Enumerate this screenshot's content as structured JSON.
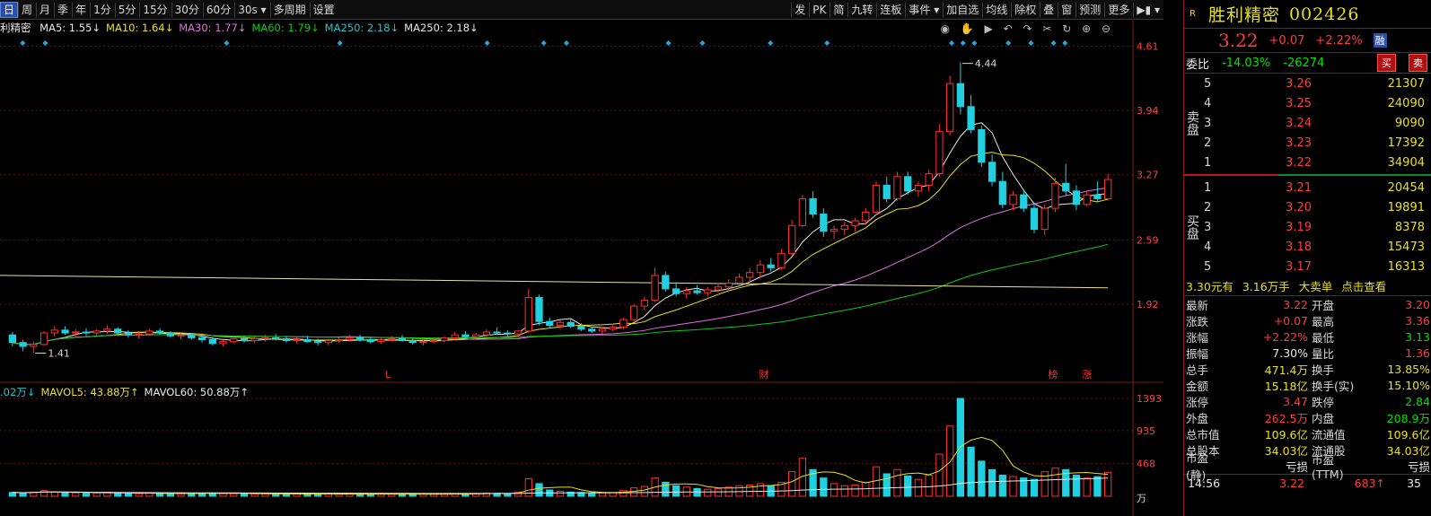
{
  "toolbar": {
    "left": [
      "日",
      "周",
      "月",
      "季",
      "年",
      "1分",
      "5分",
      "15分",
      "30分",
      "60分",
      "30s ▾",
      "多周期",
      "设置"
    ],
    "active": 0,
    "right": [
      "发",
      "PK",
      "简",
      "九转",
      "连板",
      "事件 ▾",
      "加自选",
      "均线",
      "除权",
      "叠",
      "窗",
      "预测",
      "更多",
      "▶▮ ▾"
    ]
  },
  "ma_legend": {
    "stock_prefix": "利精密",
    "items": [
      {
        "text": "MA5: 1.55↓",
        "color": "#e8e8e8"
      },
      {
        "text": "MA10: 1.64↓",
        "color": "#e8e020"
      },
      {
        "text": "MA30: 1.77↓",
        "color": "#e070e0"
      },
      {
        "text": "MA60: 1.79↓",
        "color": "#10c810"
      },
      {
        "text": "MA250: 2.18↓",
        "color": "#20c8c8"
      },
      {
        "text": "MA250: 2.18↓",
        "color": "#e8e8e8"
      }
    ]
  },
  "vol_legend": {
    "items": [
      {
        "text": ".02万↓",
        "color": "#20c8c8"
      },
      {
        "text": "MAVOL5: 43.88万↑",
        "color": "#e8e020"
      },
      {
        "text": "MAVOL60: 50.88万↑",
        "color": "#e8e8e8"
      }
    ]
  },
  "chart_data": {
    "type": "candlestick",
    "price_axis": {
      "ticks": [
        "4.61",
        "3.94",
        "3.27",
        "2.59",
        "1.92"
      ],
      "ylim": [
        1.19,
        4.68
      ]
    },
    "volume_axis": {
      "ticks": [
        "1393",
        "935",
        "468"
      ],
      "unit": "万",
      "ylim": [
        0,
        1393
      ]
    },
    "annotations": {
      "high": "4.44",
      "low": "1.41",
      "markers": [
        "L",
        "财",
        "榜",
        "涨"
      ]
    },
    "ohlc_note": "daily candles estimated from screenshot",
    "candles": [
      [
        1.6,
        1.63,
        1.48,
        1.52,
        55
      ],
      [
        1.52,
        1.55,
        1.43,
        1.48,
        48
      ],
      [
        1.48,
        1.53,
        1.41,
        1.5,
        60
      ],
      [
        1.5,
        1.64,
        1.49,
        1.62,
        80
      ],
      [
        1.62,
        1.69,
        1.58,
        1.65,
        62
      ],
      [
        1.65,
        1.69,
        1.6,
        1.62,
        54
      ],
      [
        1.62,
        1.66,
        1.57,
        1.63,
        48
      ],
      [
        1.63,
        1.67,
        1.59,
        1.62,
        44
      ],
      [
        1.62,
        1.66,
        1.58,
        1.64,
        47
      ],
      [
        1.64,
        1.7,
        1.61,
        1.66,
        58
      ],
      [
        1.66,
        1.68,
        1.6,
        1.62,
        42
      ],
      [
        1.62,
        1.65,
        1.57,
        1.6,
        40
      ],
      [
        1.6,
        1.64,
        1.56,
        1.61,
        38
      ],
      [
        1.61,
        1.66,
        1.59,
        1.64,
        43
      ],
      [
        1.64,
        1.67,
        1.6,
        1.62,
        39
      ],
      [
        1.62,
        1.64,
        1.57,
        1.59,
        41
      ],
      [
        1.59,
        1.63,
        1.55,
        1.6,
        36
      ],
      [
        1.6,
        1.62,
        1.55,
        1.57,
        37
      ],
      [
        1.57,
        1.6,
        1.52,
        1.55,
        44
      ],
      [
        1.55,
        1.58,
        1.49,
        1.51,
        46
      ],
      [
        1.51,
        1.55,
        1.48,
        1.53,
        40
      ],
      [
        1.53,
        1.58,
        1.51,
        1.56,
        38
      ],
      [
        1.56,
        1.59,
        1.52,
        1.54,
        36
      ],
      [
        1.54,
        1.58,
        1.51,
        1.56,
        34
      ],
      [
        1.56,
        1.6,
        1.53,
        1.57,
        35
      ],
      [
        1.57,
        1.61,
        1.54,
        1.56,
        33
      ],
      [
        1.56,
        1.59,
        1.52,
        1.54,
        35
      ],
      [
        1.54,
        1.58,
        1.51,
        1.55,
        34
      ],
      [
        1.55,
        1.59,
        1.52,
        1.53,
        31
      ],
      [
        1.53,
        1.56,
        1.49,
        1.52,
        33
      ],
      [
        1.52,
        1.56,
        1.49,
        1.54,
        32
      ],
      [
        1.54,
        1.58,
        1.52,
        1.55,
        30
      ],
      [
        1.55,
        1.6,
        1.53,
        1.57,
        34
      ],
      [
        1.57,
        1.6,
        1.53,
        1.55,
        33
      ],
      [
        1.55,
        1.58,
        1.51,
        1.53,
        32
      ],
      [
        1.53,
        1.57,
        1.51,
        1.55,
        31
      ],
      [
        1.55,
        1.59,
        1.53,
        1.56,
        29
      ],
      [
        1.56,
        1.6,
        1.53,
        1.54,
        30
      ],
      [
        1.54,
        1.57,
        1.5,
        1.52,
        33
      ],
      [
        1.52,
        1.55,
        1.49,
        1.53,
        32
      ],
      [
        1.53,
        1.56,
        1.51,
        1.54,
        28
      ],
      [
        1.54,
        1.58,
        1.52,
        1.57,
        30
      ],
      [
        1.57,
        1.63,
        1.55,
        1.6,
        36
      ],
      [
        1.6,
        1.64,
        1.56,
        1.58,
        35
      ],
      [
        1.58,
        1.62,
        1.55,
        1.6,
        40
      ],
      [
        1.6,
        1.66,
        1.58,
        1.63,
        46
      ],
      [
        1.63,
        1.68,
        1.6,
        1.62,
        42
      ],
      [
        1.62,
        1.65,
        1.58,
        1.61,
        38
      ],
      [
        1.61,
        1.65,
        1.58,
        1.64,
        60
      ],
      [
        1.64,
        2.08,
        1.62,
        1.99,
        250
      ],
      [
        1.99,
        2.02,
        1.7,
        1.74,
        180
      ],
      [
        1.74,
        1.78,
        1.67,
        1.7,
        90
      ],
      [
        1.7,
        1.75,
        1.66,
        1.73,
        70
      ],
      [
        1.73,
        1.76,
        1.67,
        1.69,
        60
      ],
      [
        1.69,
        1.72,
        1.64,
        1.66,
        55
      ],
      [
        1.66,
        1.69,
        1.62,
        1.64,
        50
      ],
      [
        1.64,
        1.68,
        1.61,
        1.66,
        48
      ],
      [
        1.66,
        1.7,
        1.64,
        1.68,
        52
      ],
      [
        1.68,
        1.78,
        1.66,
        1.76,
        80
      ],
      [
        1.76,
        1.92,
        1.74,
        1.9,
        120
      ],
      [
        1.9,
        2.0,
        1.86,
        1.96,
        140
      ],
      [
        1.96,
        2.3,
        1.94,
        2.22,
        260
      ],
      [
        2.22,
        2.26,
        2.05,
        2.08,
        200
      ],
      [
        2.08,
        2.15,
        2.0,
        2.03,
        150
      ],
      [
        2.03,
        2.1,
        1.98,
        2.06,
        130
      ],
      [
        2.06,
        2.12,
        2.02,
        2.04,
        110
      ],
      [
        2.04,
        2.1,
        2.0,
        2.07,
        100
      ],
      [
        2.07,
        2.14,
        2.04,
        2.1,
        110
      ],
      [
        2.1,
        2.18,
        2.06,
        2.14,
        130
      ],
      [
        2.14,
        2.24,
        2.1,
        2.2,
        150
      ],
      [
        2.2,
        2.3,
        2.16,
        2.25,
        160
      ],
      [
        2.25,
        2.38,
        2.2,
        2.33,
        180
      ],
      [
        2.33,
        2.4,
        2.26,
        2.3,
        150
      ],
      [
        2.3,
        2.5,
        2.28,
        2.45,
        200
      ],
      [
        2.45,
        2.8,
        2.43,
        2.74,
        350
      ],
      [
        2.74,
        3.06,
        2.72,
        3.02,
        540
      ],
      [
        3.02,
        3.1,
        2.82,
        2.86,
        380
      ],
      [
        2.86,
        2.92,
        2.62,
        2.68,
        260
      ],
      [
        2.68,
        2.74,
        2.6,
        2.7,
        180
      ],
      [
        2.7,
        2.78,
        2.64,
        2.74,
        150
      ],
      [
        2.74,
        2.82,
        2.68,
        2.79,
        160
      ],
      [
        2.79,
        2.92,
        2.75,
        2.88,
        200
      ],
      [
        2.88,
        3.2,
        2.85,
        3.16,
        420
      ],
      [
        3.16,
        3.25,
        2.98,
        3.02,
        320
      ],
      [
        3.02,
        3.3,
        3.0,
        3.25,
        380
      ],
      [
        3.25,
        3.3,
        3.06,
        3.1,
        290
      ],
      [
        3.1,
        3.2,
        3.04,
        3.16,
        240
      ],
      [
        3.16,
        3.32,
        3.1,
        3.28,
        300
      ],
      [
        3.28,
        3.8,
        3.25,
        3.72,
        600
      ],
      [
        3.72,
        4.3,
        3.68,
        4.22,
        1000
      ],
      [
        4.22,
        4.44,
        3.9,
        3.98,
        1393
      ],
      [
        3.98,
        4.1,
        3.7,
        3.74,
        700
      ],
      [
        3.74,
        3.78,
        3.35,
        3.4,
        500
      ],
      [
        3.4,
        3.48,
        3.15,
        3.2,
        380
      ],
      [
        3.2,
        3.3,
        2.92,
        2.96,
        300
      ],
      [
        2.96,
        3.1,
        2.9,
        3.06,
        280
      ],
      [
        3.06,
        3.12,
        2.88,
        2.92,
        260
      ],
      [
        2.92,
        2.98,
        2.66,
        2.7,
        240
      ],
      [
        2.7,
        2.96,
        2.64,
        2.92,
        350
      ],
      [
        2.92,
        3.24,
        2.88,
        3.18,
        400
      ],
      [
        3.18,
        3.38,
        3.05,
        3.1,
        380
      ],
      [
        3.1,
        3.16,
        2.9,
        2.96,
        300
      ],
      [
        2.96,
        3.1,
        2.94,
        3.06,
        260
      ],
      [
        3.06,
        3.2,
        2.98,
        3.02,
        280
      ],
      [
        3.02,
        3.28,
        3.0,
        3.22,
        340
      ]
    ]
  },
  "stock": {
    "badge": "R",
    "name": "胜利精密",
    "code": "002426",
    "price": "3.22",
    "change": "+0.07",
    "pct": "+2.22%",
    "tag": "融"
  },
  "weibi": {
    "label": "委比",
    "pct": "-14.03%",
    "diff": "-26274",
    "buy_btn": "买",
    "sell_btn": "卖"
  },
  "sell_side_label": "卖盘",
  "buy_side_label": "买盘",
  "asks": [
    {
      "lv": "5",
      "price": "3.26",
      "vol": "21307"
    },
    {
      "lv": "4",
      "price": "3.25",
      "vol": "24090"
    },
    {
      "lv": "3",
      "price": "3.24",
      "vol": "9090"
    },
    {
      "lv": "2",
      "price": "3.23",
      "vol": "17392"
    },
    {
      "lv": "1",
      "price": "3.22",
      "vol": "34904"
    }
  ],
  "bids": [
    {
      "lv": "1",
      "price": "3.21",
      "vol": "20454"
    },
    {
      "lv": "2",
      "price": "3.20",
      "vol": "19891"
    },
    {
      "lv": "3",
      "price": "3.19",
      "vol": "8378"
    },
    {
      "lv": "4",
      "price": "3.18",
      "vol": "15473"
    },
    {
      "lv": "5",
      "price": "3.17",
      "vol": "16313"
    }
  ],
  "big_order": {
    "price": "3.30元有",
    "vol": "3.16万手",
    "label": "大卖单",
    "action": "点击查看"
  },
  "stats": [
    {
      "k": "最新",
      "v": "3.22",
      "vc": "red",
      "k2": "开盘",
      "v2": "3.20",
      "v2c": "red"
    },
    {
      "k": "涨跌",
      "v": "+0.07",
      "vc": "red",
      "k2": "最高",
      "v2": "3.36",
      "v2c": "red"
    },
    {
      "k": "涨幅",
      "v": "+2.22%",
      "vc": "red",
      "k2": "最低",
      "v2": "3.13",
      "v2c": "grn"
    },
    {
      "k": "振幅",
      "v": "7.30%",
      "vc": "wht",
      "k2": "量比",
      "v2": "1.36",
      "v2c": "red"
    },
    {
      "k": "总手",
      "v": "471.4万",
      "vc": "yel",
      "k2": "换手",
      "v2": "13.85%",
      "v2c": "yel"
    },
    {
      "k": "金额",
      "v": "15.18亿",
      "vc": "yel",
      "k2": "换手(实)",
      "v2": "15.10%",
      "v2c": "yel"
    },
    {
      "k": "涨停",
      "v": "3.47",
      "vc": "red",
      "k2": "跌停",
      "v2": "2.84",
      "v2c": "grn"
    },
    {
      "k": "外盘",
      "v": "262.5万",
      "vc": "red",
      "k2": "内盘",
      "v2": "208.9万",
      "v2c": "grn"
    },
    {
      "k": "总市值",
      "v": "109.6亿",
      "vc": "yel",
      "k2": "流通值",
      "v2": "109.6亿",
      "v2c": "yel"
    },
    {
      "k": "总股本",
      "v": "34.03亿",
      "vc": "yel",
      "k2": "流通股",
      "v2": "34.03亿",
      "v2c": "yel"
    },
    {
      "k": "市盈(静)",
      "v": "亏损",
      "vc": "wht",
      "k2": "市盈(TTM)",
      "v2": "亏损",
      "v2c": "wht"
    }
  ],
  "ticker": {
    "time": "14:56",
    "price": "3.22",
    "qty": "683↑",
    "n": "35"
  }
}
